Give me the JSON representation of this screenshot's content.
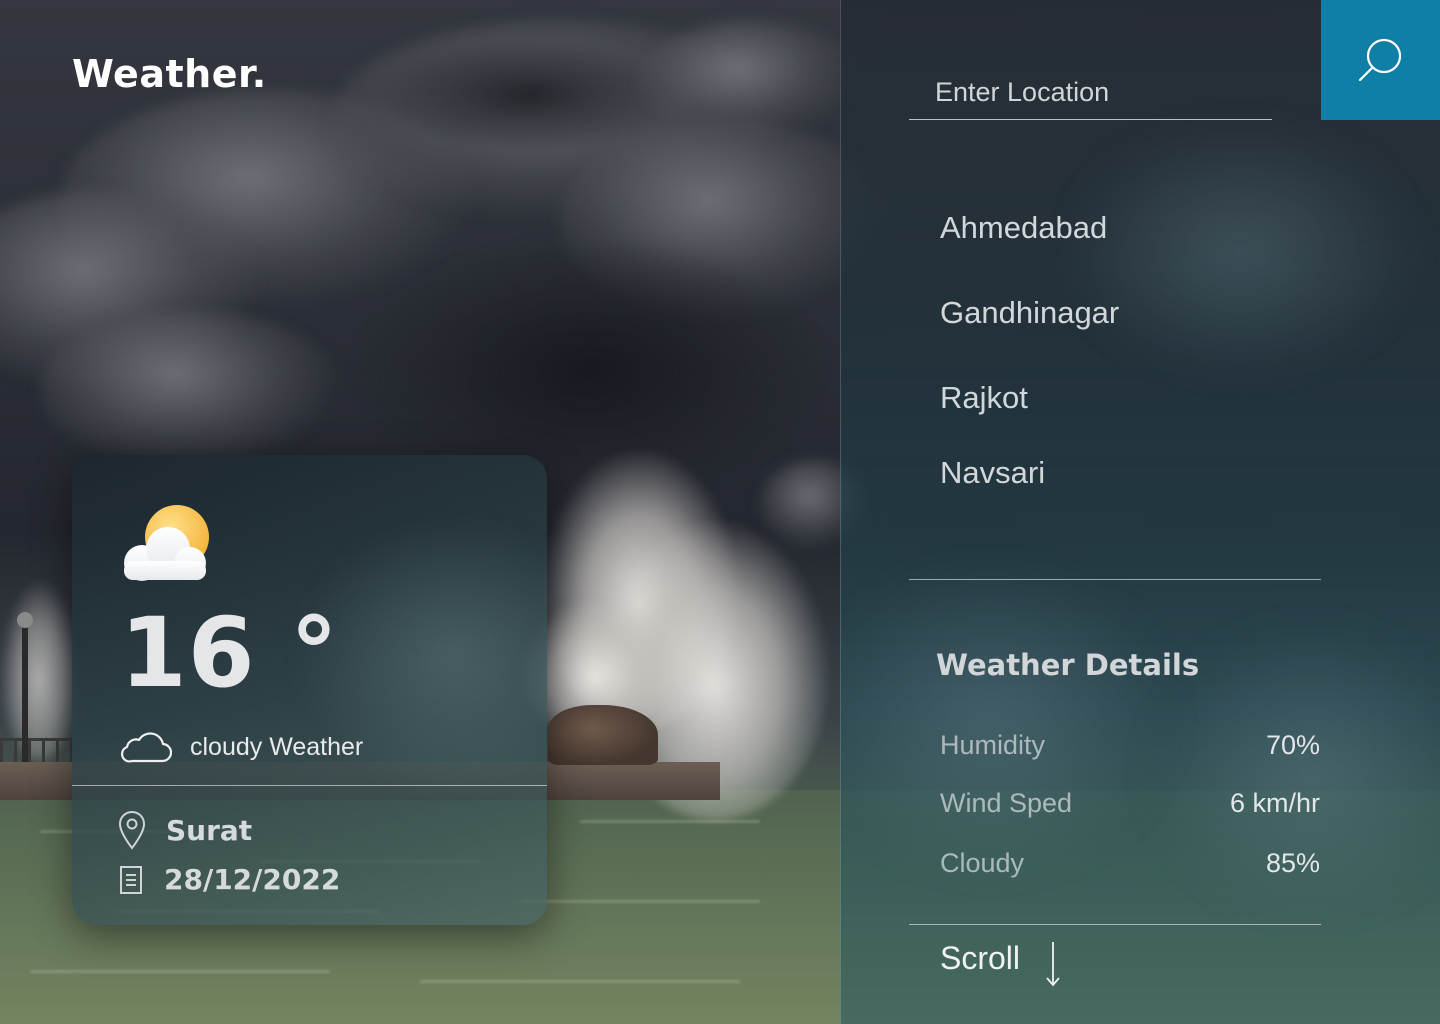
{
  "app": {
    "brand": "Weather."
  },
  "current": {
    "temperature": "16 °",
    "condition": "cloudy Weather",
    "city": "Surat",
    "date": "28/12/2022",
    "condition_icon": "sun-behind-cloud-icon"
  },
  "search": {
    "placeholder": "Enter Location",
    "value": "",
    "button_icon": "search-icon"
  },
  "cities": [
    "Ahmedabad",
    "Gandhinagar",
    "Rajkot",
    "Navsari"
  ],
  "details": {
    "title": "Weather Details",
    "items": [
      {
        "label": "Humidity",
        "value": "70%"
      },
      {
        "label": "Wind Sped",
        "value": "6 km/hr"
      },
      {
        "label": "Cloudy",
        "value": "85%"
      }
    ]
  },
  "scroll": {
    "label": "Scroll",
    "icon": "arrow-down-icon"
  },
  "colors": {
    "accent": "#0f7fa6",
    "text": "#ffffff"
  }
}
